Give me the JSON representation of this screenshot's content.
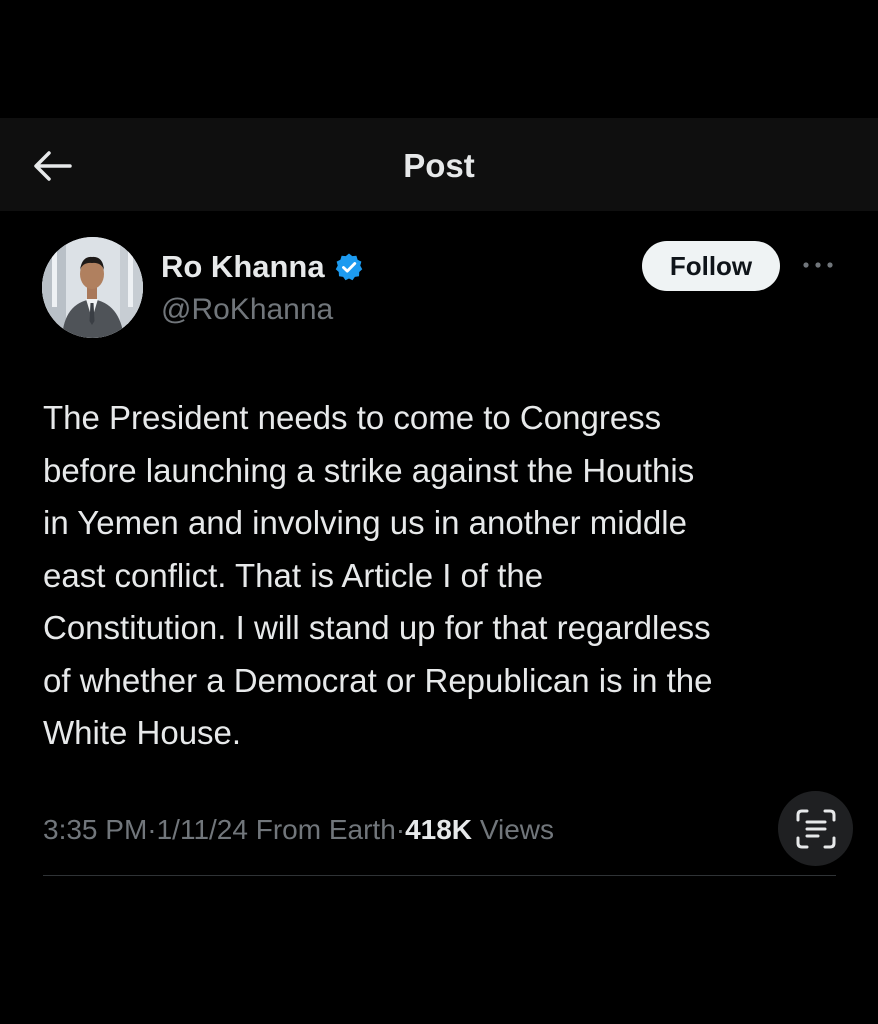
{
  "header": {
    "title": "Post",
    "back_icon": "arrow-left-icon"
  },
  "post": {
    "author": {
      "name": "Ro Khanna",
      "handle": "@RoKhanna",
      "verified": true,
      "verified_icon": "verified-badge-icon"
    },
    "follow_label": "Follow",
    "more_icon": "more-options-icon",
    "text": "The President needs to come to Congress\nbefore launching a strike against the Houthis\nin Yemen and involving us in another middle\neast conflict. That is Article I of the\nConstitution. I will stand up for that regardless\nof whether a Democrat or Republican is in the\nWhite House.",
    "time": "3:35 PM",
    "separator": " · ",
    "date": "1/11/24",
    "source": "From Earth",
    "views_count": "418K",
    "views_label": "Views",
    "scan_icon": "live-text-icon"
  },
  "colors": {
    "background": "#000000",
    "header_background": "#0f0f0f",
    "primary_text": "#e7e9ea",
    "secondary_text": "#71767b",
    "verified_blue": "#1d9bf0",
    "follow_button_bg": "#eff3f4",
    "divider": "#2f3336"
  }
}
